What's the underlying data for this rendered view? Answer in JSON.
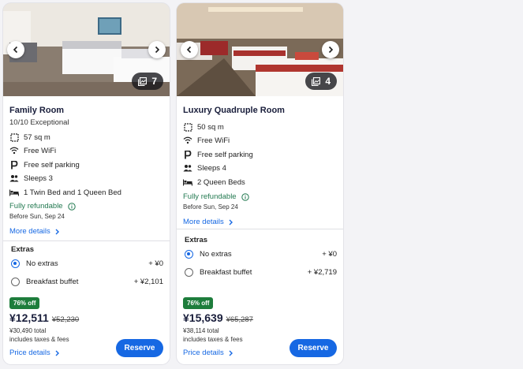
{
  "colors": {
    "accent": "#1668e3",
    "refundable": "#227950",
    "discount_badge": "#1e7d3c"
  },
  "rooms": [
    {
      "name": "Family Room",
      "rating": "10/10 Exceptional",
      "photo_count": "7",
      "amenities": [
        {
          "icon": "floor-plan-icon",
          "text": "57 sq m"
        },
        {
          "icon": "wifi-icon",
          "text": "Free WiFi"
        },
        {
          "icon": "parking-icon",
          "text": "Free self parking"
        },
        {
          "icon": "people-icon",
          "text": "Sleeps 3"
        },
        {
          "icon": "bed-icon",
          "text": "1 Twin Bed and 1 Queen Bed"
        }
      ],
      "refund_label": "Fully refundable",
      "refund_date": "Before Sun, Sep 24",
      "more_details": "More details",
      "extras_title": "Extras",
      "extras": [
        {
          "label": "No extras",
          "price": "+ ¥0",
          "selected": true
        },
        {
          "label": "Breakfast buffet",
          "price": "+ ¥2,101",
          "selected": false
        }
      ],
      "discount": "76% off",
      "price_now": "¥12,511",
      "price_was": "¥52,230",
      "total": "¥30,490 total",
      "taxes": "includes taxes & fees",
      "price_details": "Price details",
      "reserve": "Reserve"
    },
    {
      "name": "Luxury Quadruple Room",
      "rating": "",
      "photo_count": "4",
      "amenities": [
        {
          "icon": "floor-plan-icon",
          "text": "50 sq m"
        },
        {
          "icon": "wifi-icon",
          "text": "Free WiFi"
        },
        {
          "icon": "parking-icon",
          "text": "Free self parking"
        },
        {
          "icon": "people-icon",
          "text": "Sleeps 4"
        },
        {
          "icon": "bed-icon",
          "text": "2 Queen Beds"
        }
      ],
      "refund_label": "Fully refundable",
      "refund_date": "Before Sun, Sep 24",
      "more_details": "More details",
      "extras_title": "Extras",
      "extras": [
        {
          "label": "No extras",
          "price": "+ ¥0",
          "selected": true
        },
        {
          "label": "Breakfast buffet",
          "price": "+ ¥2,719",
          "selected": false
        }
      ],
      "discount": "76% off",
      "price_now": "¥15,639",
      "price_was": "¥65,287",
      "total": "¥38,114 total",
      "taxes": "includes taxes & fees",
      "price_details": "Price details",
      "reserve": "Reserve"
    }
  ]
}
